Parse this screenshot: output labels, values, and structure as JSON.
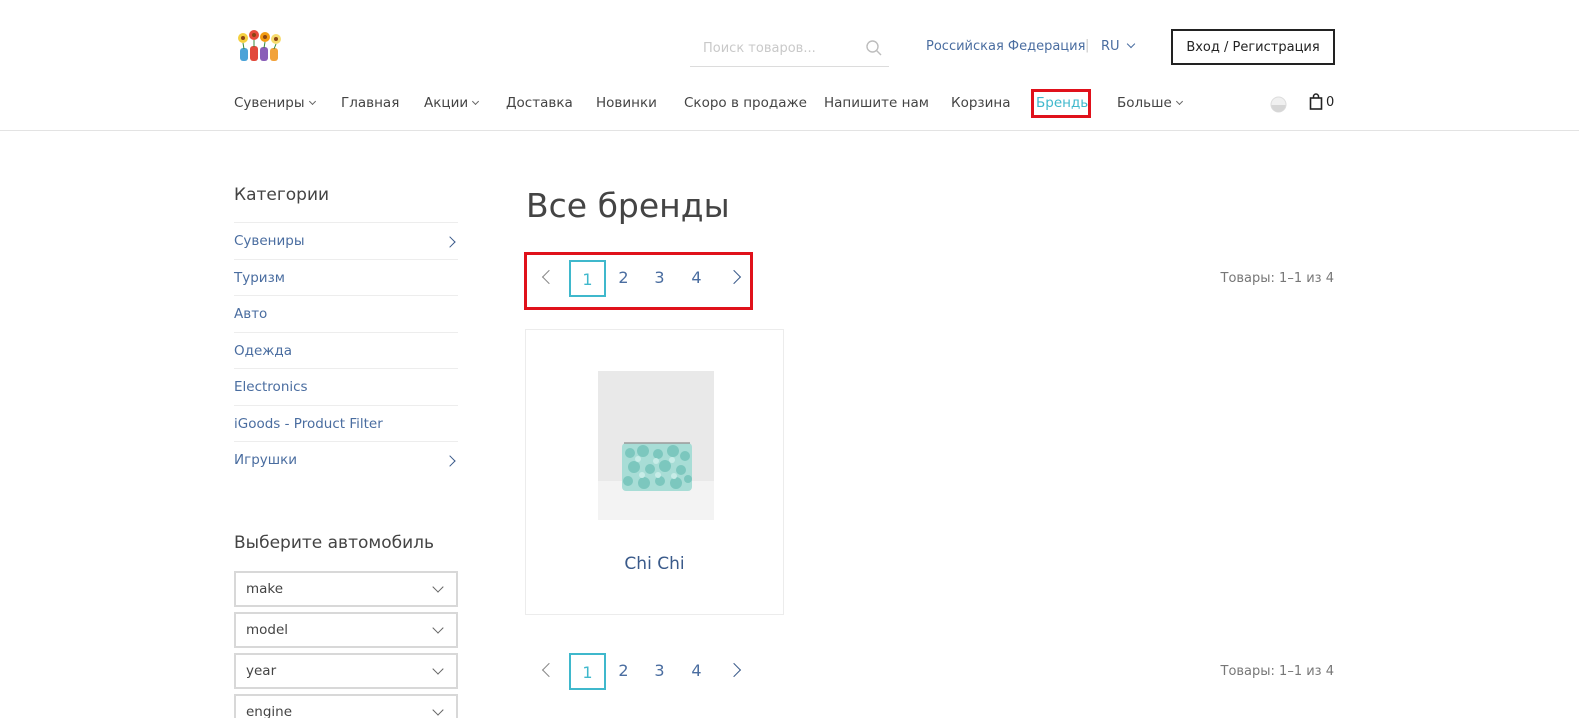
{
  "header": {
    "search_placeholder": "Поиск товаров...",
    "region": "Российская Федерация",
    "separator": "|",
    "lang": "RU",
    "login_label": "Вход / Регистрация",
    "cart_count": "0"
  },
  "nav": {
    "items": [
      {
        "label": "Сувениры",
        "dropdown": true
      },
      {
        "label": "Главная"
      },
      {
        "label": "Акции",
        "dropdown": true
      },
      {
        "label": "Доставка"
      },
      {
        "label": "Новинки"
      },
      {
        "label": "Скоро в продаже"
      },
      {
        "label": "Напишите нам"
      },
      {
        "label": "Корзина"
      },
      {
        "label": "Бренды",
        "active": true
      },
      {
        "label": "Больше",
        "dropdown": true
      }
    ]
  },
  "sidebar": {
    "categories_title": "Категории",
    "categories": [
      {
        "label": "Сувениры",
        "has_children": true
      },
      {
        "label": "Туризм"
      },
      {
        "label": "Авто"
      },
      {
        "label": "Одежда"
      },
      {
        "label": "Electronics"
      },
      {
        "label": "iGoods - Product Filter"
      },
      {
        "label": "Игрушки",
        "has_children": true
      }
    ],
    "car_title": "Выберите автомобиль",
    "car_selects": [
      "make",
      "model",
      "year",
      "engine"
    ]
  },
  "main": {
    "title": "Все бренды",
    "pages": [
      "1",
      "2",
      "3",
      "4"
    ],
    "current_page": "1",
    "count_text": "Товары: 1–1 из 4",
    "brand": {
      "name": "Chi Chi"
    }
  },
  "colors": {
    "accent": "#3fb8cc",
    "link": "#4a6da0",
    "highlight": "#e0111b"
  }
}
